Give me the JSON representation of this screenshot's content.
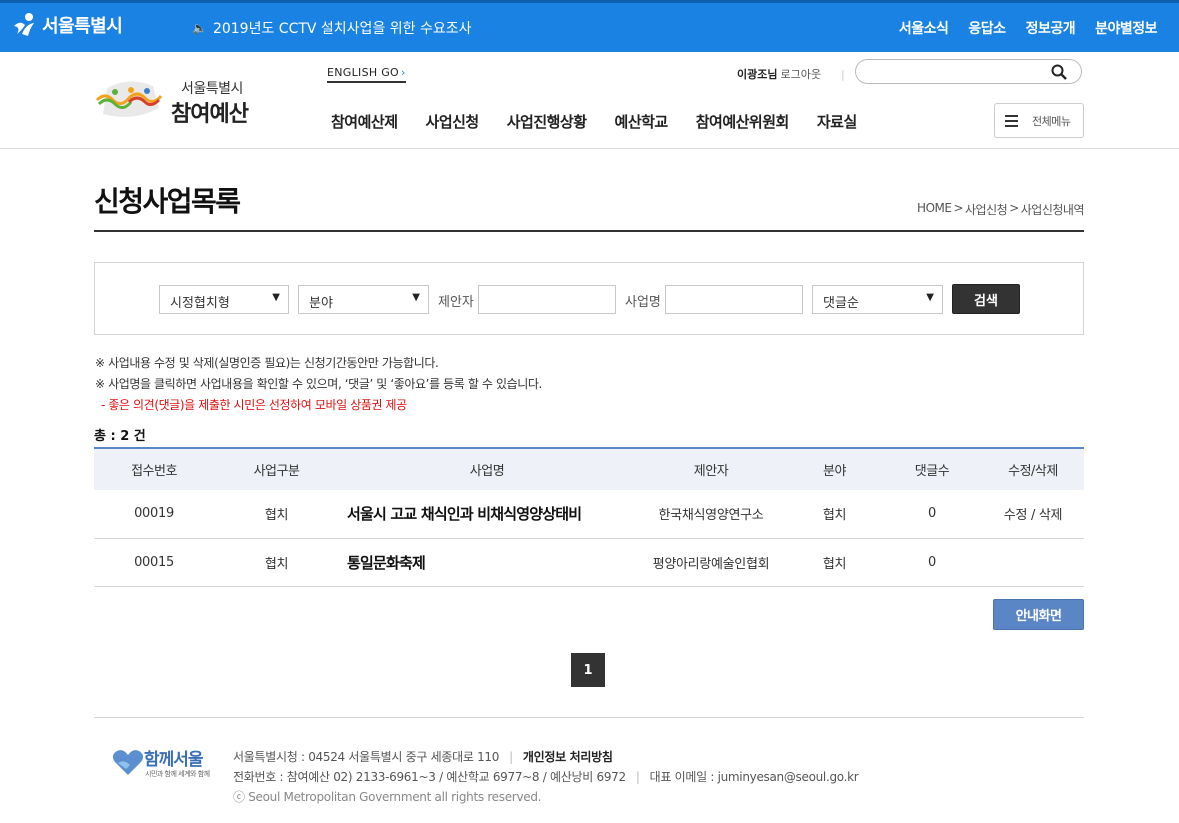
{
  "topbar": {
    "city_name": "서울특별시",
    "notice": "2019년도 CCTV 설치사업을 위한 수요조사",
    "links": [
      "서울소식",
      "응답소",
      "정보공개",
      "분야별정보"
    ],
    "bg_color": "#1a82e2"
  },
  "header": {
    "logo_sub": "서울특별시",
    "logo_main": "참여예산",
    "english": "ENGLISH GO",
    "user_name": "이광조님",
    "logout": "로그아웃",
    "search_placeholder": "",
    "gnb": [
      "참여예산제",
      "사업신청",
      "사업진행상황",
      "예산학교",
      "참여예산위원회",
      "자료실"
    ],
    "allmenu": "전체메뉴"
  },
  "page": {
    "title": "신청사업목록",
    "breadcrumb": [
      "HOME",
      "사업신청",
      "사업신청내역"
    ]
  },
  "search": {
    "type_selected": "시정협치형",
    "field_selected": "분야",
    "proposer_label": "제안자",
    "proposer_value": "",
    "project_label": "사업명",
    "project_value": "",
    "sort_selected": "댓글순",
    "button": "검색"
  },
  "notes": {
    "line1": "※ 사업내용 수정 및 삭제(실명인증 필요)는 신청기간동안만 가능합니다.",
    "line2": "※ 사업명을 클릭하면 사업내용을 확인할 수 있으며, ‘댓글’ 및 ‘좋아요’를 등록 할 수 있습니다.",
    "line3": "- 좋은 의견(댓글)을 제출한 시민은 선정하여 모바일 상품권 제공"
  },
  "total": "총 : 2 건",
  "table": {
    "headers": [
      "접수번호",
      "사업구분",
      "사업명",
      "제안자",
      "분야",
      "댓글수",
      "수정/삭제"
    ],
    "rows": [
      {
        "no": "00019",
        "kind": "협치",
        "title": "서울시 고교 채식인과 비채식영양상태비",
        "proposer": "한국채식영양연구소",
        "field": "협치",
        "comments": "0",
        "edit": "수정",
        "slash": "/",
        "del": "삭제"
      },
      {
        "no": "00015",
        "kind": "협치",
        "title": "통일문화축제",
        "proposer": "평양아리랑예술인협회",
        "field": "협치",
        "comments": "0",
        "edit": "",
        "slash": "",
        "del": ""
      }
    ]
  },
  "guide_button": "안내화면",
  "pagination": {
    "current": "1"
  },
  "footer": {
    "logo_text": "함께서울",
    "slogan": "시민과 함께 세계와 함께",
    "address": "서울특별시청 : 04524 서울특별시 중구 세종대로 110",
    "privacy": "개인정보 처리방침",
    "phone": "전화번호 : 참여예산 02) 2133-6961~3 / 예산학교 6977~8 / 예산낭비 6972",
    "email": "대표 이메일 : juminyesan@seoul.go.kr",
    "copyright": "ⓒ Seoul Metropolitan Government all rights reserved."
  }
}
